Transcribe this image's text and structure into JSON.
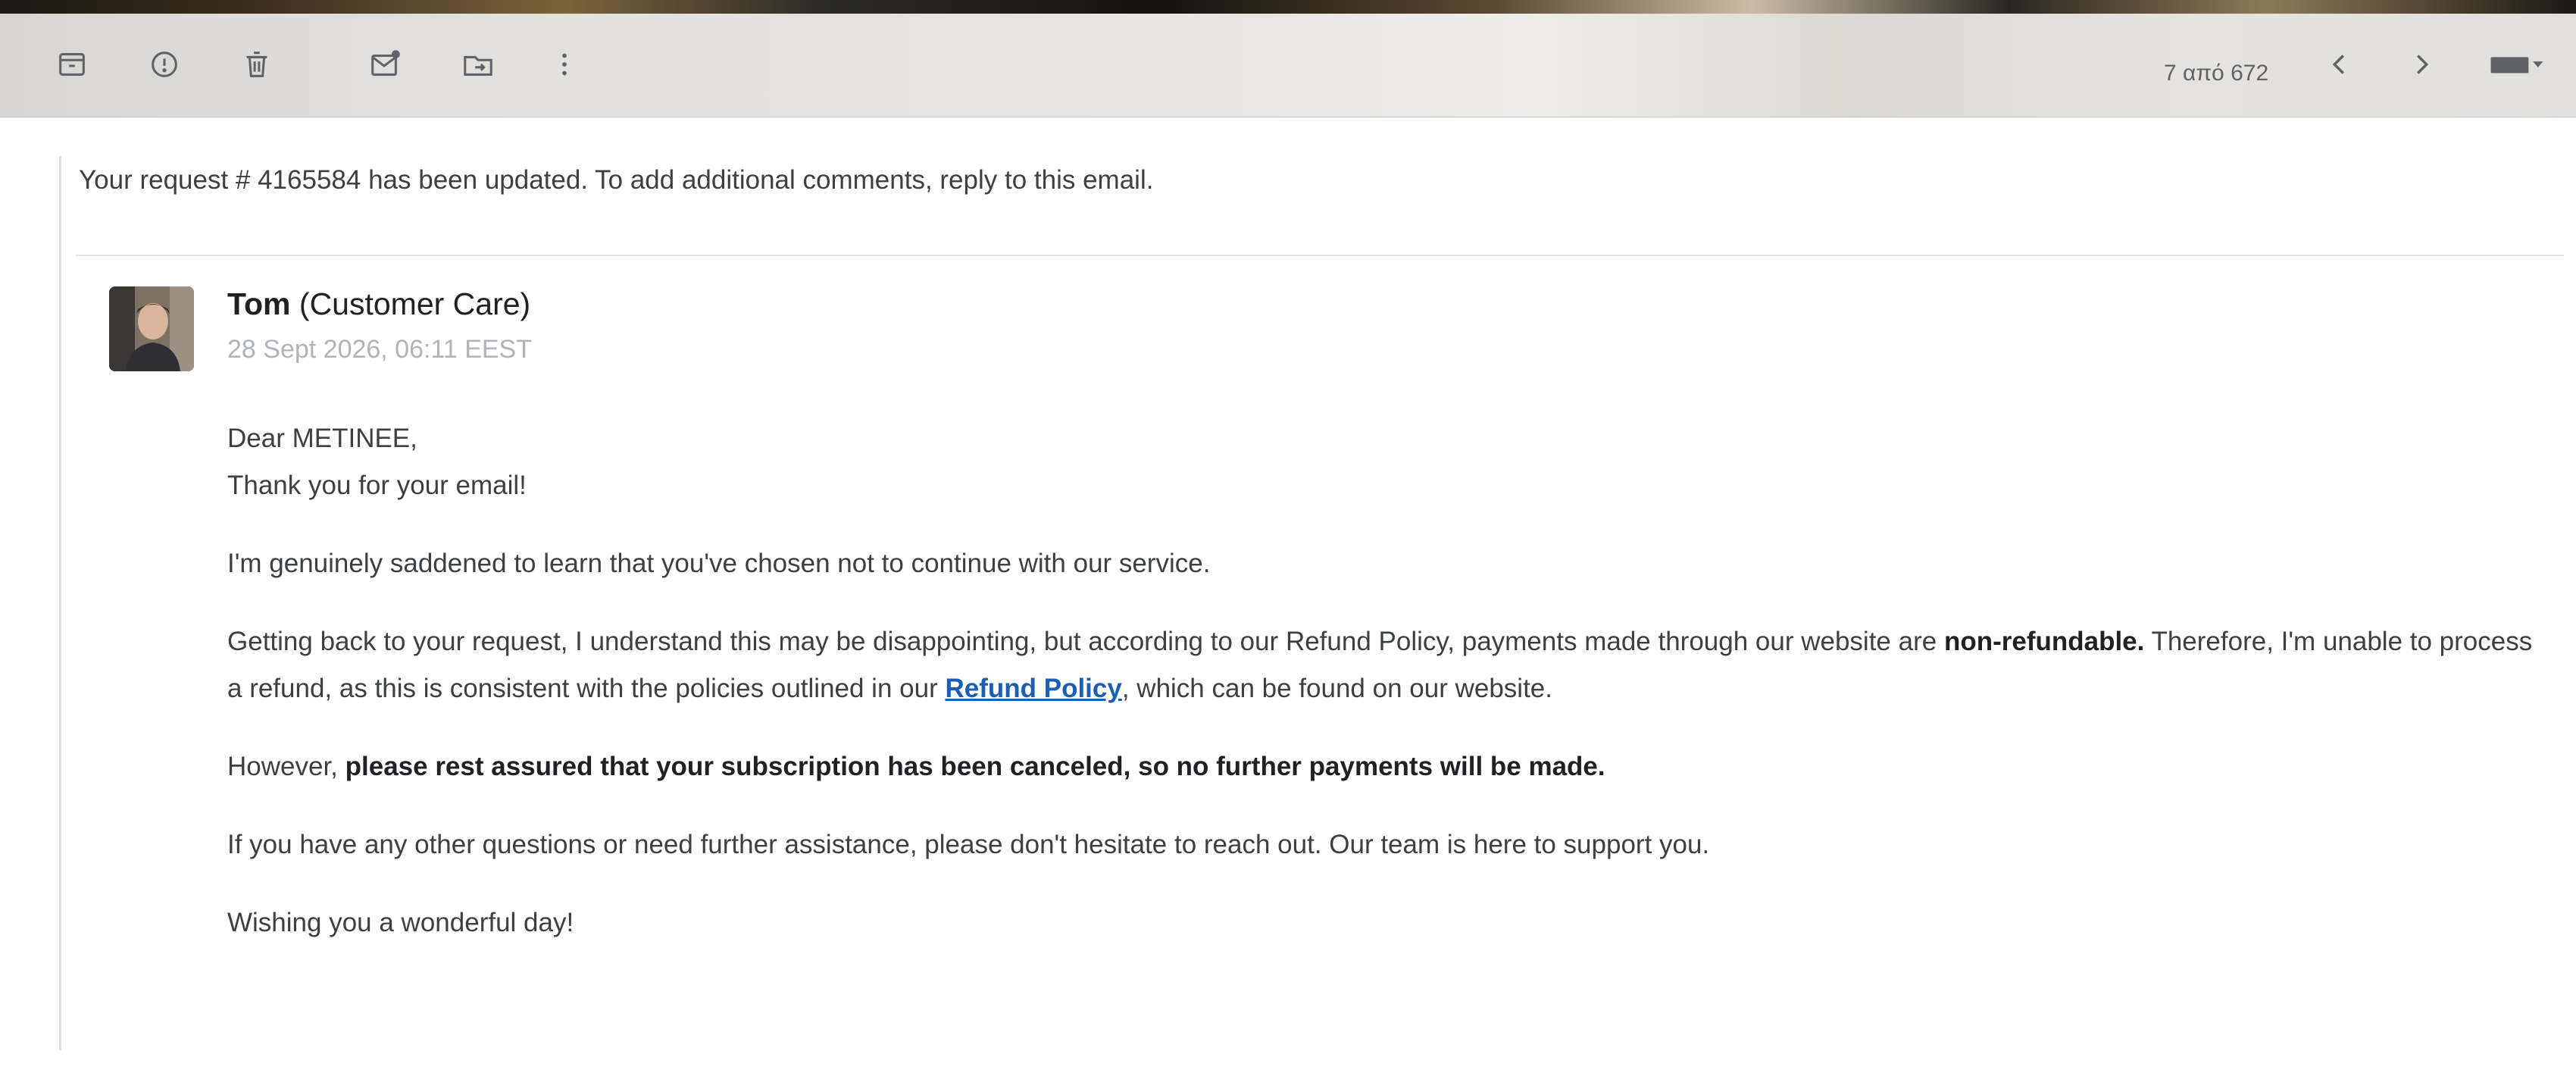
{
  "toolbar": {
    "icons": [
      "archive-icon",
      "report-spam-icon",
      "delete-icon",
      "mark-unread-icon",
      "move-to-icon",
      "more-icon",
      "chevron-left-icon",
      "chevron-right-icon",
      "input-tools-icon"
    ],
    "page_count": "7 από 672"
  },
  "email": {
    "notice": "Your request # 4165584 has been updated. To add additional comments, reply to this email.",
    "sender_name": "Tom",
    "sender_role": "(Customer Care)",
    "date": "28 Sept 2026, 06:11 EEST",
    "greeting": "Dear METINEE,",
    "thanks": "Thank you for your email!",
    "para1": "I'm genuinely saddened to learn that you've chosen not to continue with our service.",
    "para2_start": "Getting back to your request, I understand this may be disappointing, but according to our Refund Policy, payments made through our website are ",
    "para2_bold": "non-refundable.",
    "para2_mid": " Therefore, I'm unable to process a refund, as this is consistent with the policies outlined in our ",
    "para2_link": "Refund Policy",
    "para2_end": ", which can be found on our website.",
    "para3_start": "However, ",
    "para3_bold": "please rest assured that your subscription has been canceled, so no further payments will be made.",
    "para4": "If you have any other questions or need further assistance, please don't hesitate to reach out. Our team is here to support you.",
    "closing": "Wishing you a wonderful day!"
  },
  "colors": {
    "link": "#1a5fb4",
    "muted_text": "#b0b3b8",
    "icon": "#5f6368"
  }
}
